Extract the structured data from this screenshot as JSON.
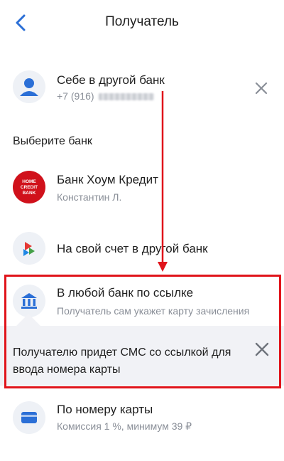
{
  "header": {
    "title": "Получатель"
  },
  "recipient": {
    "name": "Себе в другой банк",
    "phone_prefix": "+7 (916)"
  },
  "section_title": "Выберите банк",
  "banks": [
    {
      "title": "Банк Хоум Кредит",
      "subtitle": "Константин Л.",
      "logo_text": "HOME CREDIT BANK"
    },
    {
      "title": "На свой счет в другой банк"
    },
    {
      "title": "В любой банк по ссылке",
      "subtitle": "Получатель сам укажет карту зачисления"
    },
    {
      "title": "По номеру карты",
      "subtitle": "Комиссия 1 %, минимум 39 ₽"
    }
  ],
  "hint": {
    "text": "Получателю придет СМС со ссылкой для ввода номера карты"
  },
  "colors": {
    "accent": "#2b6fd6",
    "annotation": "#e0141b",
    "home_credit": "#d0111b"
  }
}
